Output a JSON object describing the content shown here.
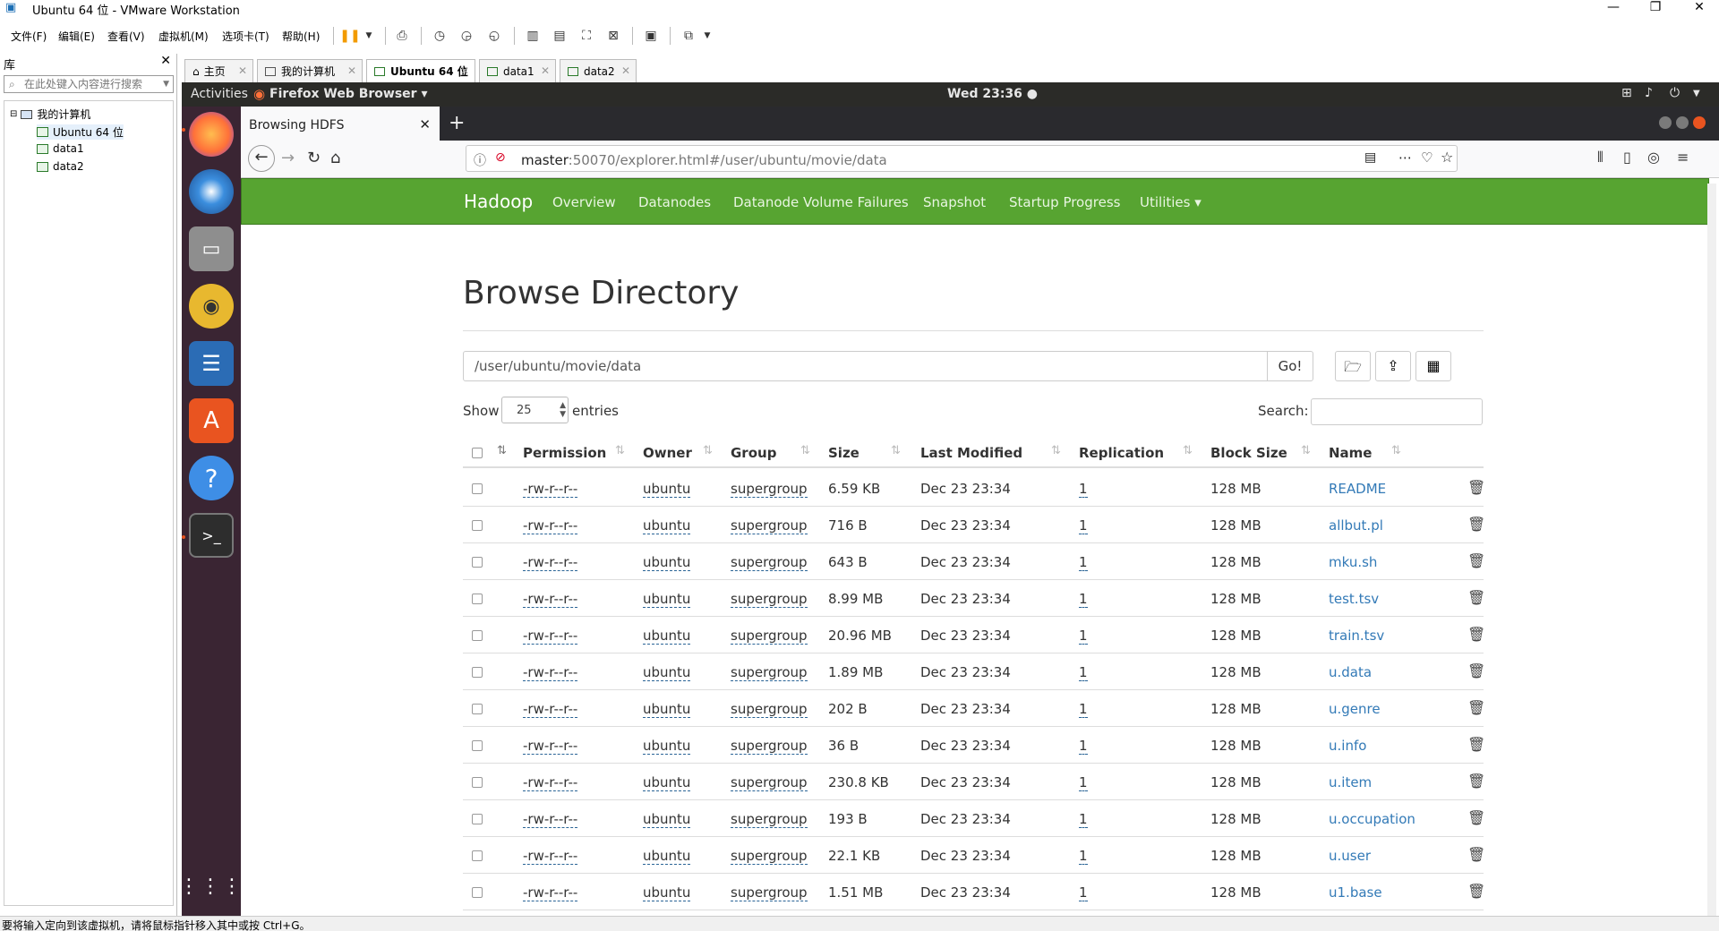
{
  "window": {
    "title": "Ubuntu 64 位 - VMware Workstation",
    "controls": [
      "—",
      "❐",
      "✕"
    ]
  },
  "menu": {
    "items": [
      "文件(F)",
      "编辑(E)",
      "查看(V)",
      "虚拟机(M)",
      "选项卡(T)",
      "帮助(H)"
    ]
  },
  "library": {
    "header": "库",
    "close": "✕",
    "search_placeholder": "在此处键入内容进行搜索",
    "root": "我的计算机",
    "children": [
      "Ubuntu 64 位",
      "data1",
      "data2"
    ]
  },
  "vm_tabs": [
    {
      "label": "主页",
      "close": "✕"
    },
    {
      "label": "我的计算机",
      "close": "✕"
    },
    {
      "label": "Ubuntu 64 位",
      "close": "✕"
    },
    {
      "label": "data1",
      "close": "✕"
    },
    {
      "label": "data2",
      "close": "✕"
    }
  ],
  "gnome": {
    "activities": "Activities",
    "app": "Firefox Web Browser ▾",
    "clock": "Wed 23:36 ●"
  },
  "firefox": {
    "tab_title": "Browsing HDFS",
    "tab_close": "✕",
    "new_tab": "+",
    "url_host": "master",
    "url_rest": ":50070/explorer.html#/user/ubuntu/movie/data"
  },
  "hadoop": {
    "brand": "Hadoop",
    "nav": [
      "Overview",
      "Datanodes",
      "Datanode Volume Failures",
      "Snapshot",
      "Startup Progress",
      "Utilities ▾"
    ],
    "page_title": "Browse Directory",
    "path": "/user/ubuntu/movie/data",
    "go": "Go!",
    "show_label": "Show",
    "show_value": "25",
    "entries_label": "entries",
    "search_label": "Search:",
    "columns": [
      "Permission",
      "Owner",
      "Group",
      "Size",
      "Last Modified",
      "Replication",
      "Block Size",
      "Name"
    ],
    "rows": [
      {
        "perm": "-rw-r--r--",
        "owner": "ubuntu",
        "group": "supergroup",
        "size": "6.59 KB",
        "modified": "Dec 23 23:34",
        "repl": "1",
        "block": "128 MB",
        "name": "README"
      },
      {
        "perm": "-rw-r--r--",
        "owner": "ubuntu",
        "group": "supergroup",
        "size": "716 B",
        "modified": "Dec 23 23:34",
        "repl": "1",
        "block": "128 MB",
        "name": "allbut.pl"
      },
      {
        "perm": "-rw-r--r--",
        "owner": "ubuntu",
        "group": "supergroup",
        "size": "643 B",
        "modified": "Dec 23 23:34",
        "repl": "1",
        "block": "128 MB",
        "name": "mku.sh"
      },
      {
        "perm": "-rw-r--r--",
        "owner": "ubuntu",
        "group": "supergroup",
        "size": "8.99 MB",
        "modified": "Dec 23 23:34",
        "repl": "1",
        "block": "128 MB",
        "name": "test.tsv"
      },
      {
        "perm": "-rw-r--r--",
        "owner": "ubuntu",
        "group": "supergroup",
        "size": "20.96 MB",
        "modified": "Dec 23 23:34",
        "repl": "1",
        "block": "128 MB",
        "name": "train.tsv"
      },
      {
        "perm": "-rw-r--r--",
        "owner": "ubuntu",
        "group": "supergroup",
        "size": "1.89 MB",
        "modified": "Dec 23 23:34",
        "repl": "1",
        "block": "128 MB",
        "name": "u.data"
      },
      {
        "perm": "-rw-r--r--",
        "owner": "ubuntu",
        "group": "supergroup",
        "size": "202 B",
        "modified": "Dec 23 23:34",
        "repl": "1",
        "block": "128 MB",
        "name": "u.genre"
      },
      {
        "perm": "-rw-r--r--",
        "owner": "ubuntu",
        "group": "supergroup",
        "size": "36 B",
        "modified": "Dec 23 23:34",
        "repl": "1",
        "block": "128 MB",
        "name": "u.info"
      },
      {
        "perm": "-rw-r--r--",
        "owner": "ubuntu",
        "group": "supergroup",
        "size": "230.8 KB",
        "modified": "Dec 23 23:34",
        "repl": "1",
        "block": "128 MB",
        "name": "u.item"
      },
      {
        "perm": "-rw-r--r--",
        "owner": "ubuntu",
        "group": "supergroup",
        "size": "193 B",
        "modified": "Dec 23 23:34",
        "repl": "1",
        "block": "128 MB",
        "name": "u.occupation"
      },
      {
        "perm": "-rw-r--r--",
        "owner": "ubuntu",
        "group": "supergroup",
        "size": "22.1 KB",
        "modified": "Dec 23 23:34",
        "repl": "1",
        "block": "128 MB",
        "name": "u.user"
      },
      {
        "perm": "-rw-r--r--",
        "owner": "ubuntu",
        "group": "supergroup",
        "size": "1.51 MB",
        "modified": "Dec 23 23:34",
        "repl": "1",
        "block": "128 MB",
        "name": "u1.base"
      }
    ]
  },
  "status_bar": "要将输入定向到该虚拟机，请将鼠标指针移入其中或按 Ctrl+G。",
  "colors": {
    "hadoop_green": "#57a431",
    "dock": "#3a2533",
    "gnome_bar": "#2b2b28",
    "link": "#337ab7"
  },
  "icons": [
    "vmware-logo-icon",
    "pause-icon",
    "snapshot-icon",
    "terminal-icon",
    "firefox-icon",
    "thunderbird-icon",
    "files-icon",
    "rhythmbox-icon",
    "writer-icon",
    "software-icon",
    "help-icon",
    "apps-grid-icon",
    "trash-icon",
    "folder-icon",
    "upload-icon",
    "table-icon"
  ]
}
